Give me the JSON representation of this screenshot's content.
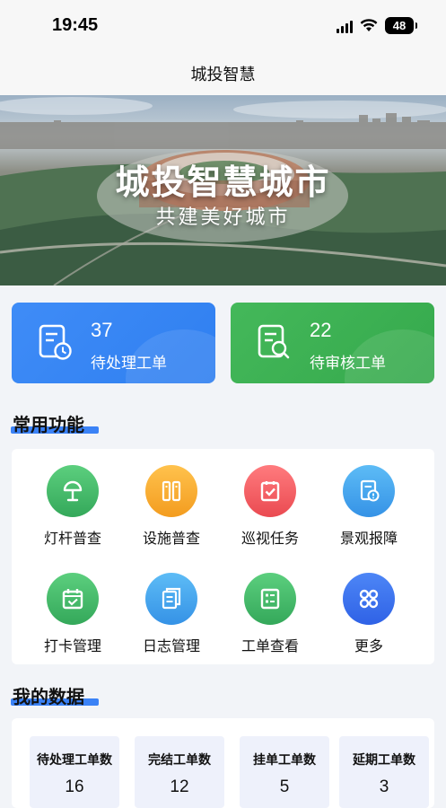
{
  "status_bar": {
    "time": "19:45",
    "battery": "48"
  },
  "nav": {
    "title": "城投智慧"
  },
  "banner": {
    "title": "城投智慧城市",
    "subtitle": "共建美好城市"
  },
  "stats": [
    {
      "value": "37",
      "label": "待处理工单",
      "color": "#3a88f5",
      "icon": "clock-document-icon"
    },
    {
      "value": "22",
      "label": "待审核工单",
      "color": "#3eb254",
      "icon": "search-document-icon"
    }
  ],
  "functions_section": {
    "title": "常用功能",
    "items": [
      {
        "label": "灯杆普查",
        "icon": "lamp-icon",
        "color": "#3db363"
      },
      {
        "label": "设施普查",
        "icon": "facility-icon",
        "color": "#f5a623"
      },
      {
        "label": "巡视任务",
        "icon": "task-check-icon",
        "color": "#f0555a"
      },
      {
        "label": "景观报障",
        "icon": "report-icon",
        "color": "#3da4ee"
      },
      {
        "label": "打卡管理",
        "icon": "calendar-check-icon",
        "color": "#3db363"
      },
      {
        "label": "日志管理",
        "icon": "log-icon",
        "color": "#3da4ee"
      },
      {
        "label": "工单查看",
        "icon": "order-list-icon",
        "color": "#3db363"
      },
      {
        "label": "更多",
        "icon": "more-grid-icon",
        "color": "#3f6ff0"
      }
    ]
  },
  "data_section": {
    "title": "我的数据",
    "items": [
      {
        "label": "待处理工单数",
        "value": "16"
      },
      {
        "label": "完结工单数",
        "value": "12"
      },
      {
        "label": "挂单工单数",
        "value": "5"
      },
      {
        "label": "延期工单数",
        "value": "3"
      }
    ]
  }
}
